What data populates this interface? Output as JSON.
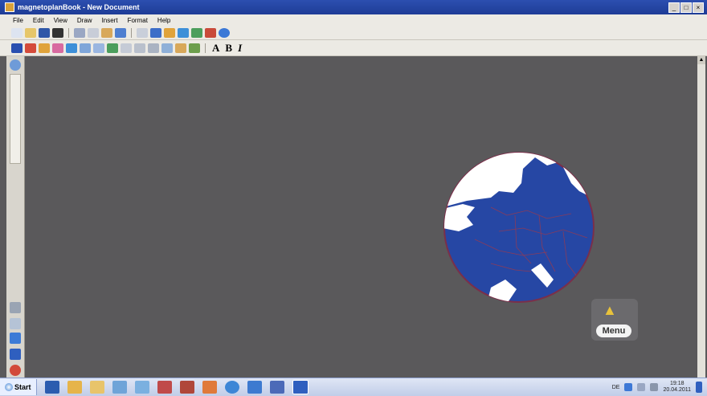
{
  "window": {
    "title": "magnetoplanBook - New Document",
    "buttons": [
      "_",
      "□",
      "×"
    ]
  },
  "menu": [
    "File",
    "Edit",
    "View",
    "Draw",
    "Insert",
    "Format",
    "Help"
  ],
  "toolbar_text_tools": {
    "bold_label": "A",
    "bold_b": "B",
    "italic_label": "I"
  },
  "canvas_button": {
    "label": "Menu",
    "icon": "spotlight-icon"
  },
  "taskbar": {
    "start_label": "Start",
    "language": "DE",
    "time": "19:18",
    "date": "20.04.2011"
  },
  "colors": {
    "canvas": "#5a595b",
    "globe_sea": "#2647a4",
    "globe_land": "#ffffff"
  }
}
